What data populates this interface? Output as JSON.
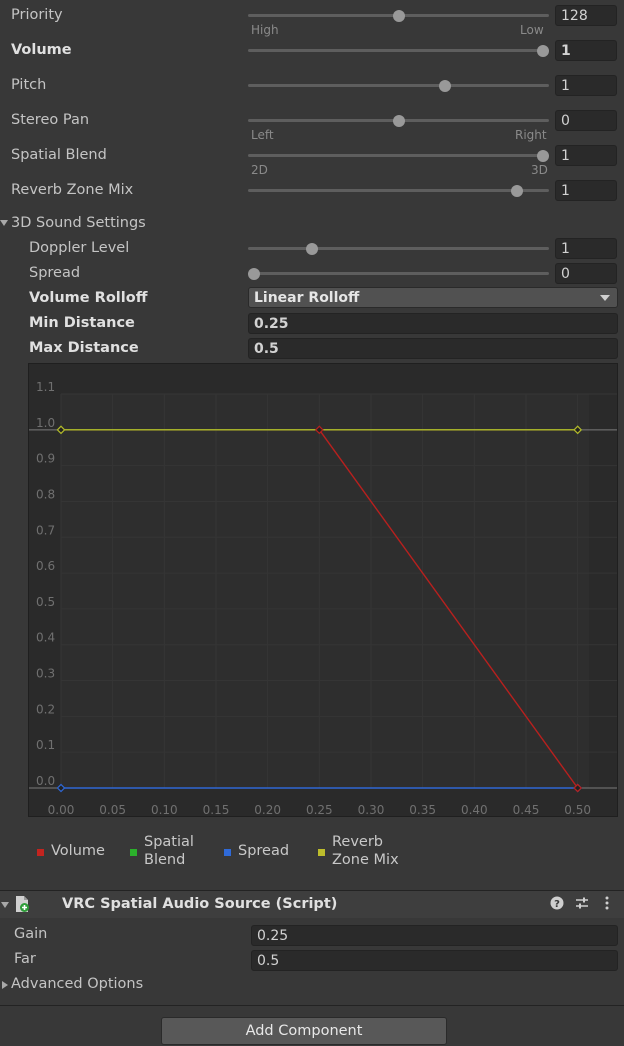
{
  "audio_source": {
    "priority": {
      "label": "Priority",
      "value": "128",
      "min_label": "High",
      "max_label": "Low",
      "fraction": 0.5
    },
    "volume": {
      "label": "Volume",
      "value": "1",
      "fraction": 1.0
    },
    "pitch": {
      "label": "Pitch",
      "value": "1",
      "fraction": 0.66
    },
    "stereo_pan": {
      "label": "Stereo Pan",
      "value": "0",
      "min_label": "Left",
      "max_label": "Right",
      "fraction": 0.5
    },
    "spatial_blend": {
      "label": "Spatial Blend",
      "value": "1",
      "min_label": "2D",
      "max_label": "3D",
      "fraction": 1.0
    },
    "reverb_zone_mix": {
      "label": "Reverb Zone Mix",
      "value": "1",
      "fraction": 0.91
    }
  },
  "sound3d": {
    "header": "3D Sound Settings",
    "doppler_level": {
      "label": "Doppler Level",
      "value": "1",
      "fraction": 0.2
    },
    "spread": {
      "label": "Spread",
      "value": "0",
      "fraction": 0.0
    },
    "volume_rolloff": {
      "label": "Volume Rolloff",
      "value": "Linear Rolloff"
    },
    "min_distance": {
      "label": "Min Distance",
      "value": "0.25"
    },
    "max_distance": {
      "label": "Max Distance",
      "value": "0.5"
    }
  },
  "chart_data": {
    "type": "line",
    "title": "",
    "xlabel": "",
    "ylabel": "",
    "xlim": [
      0,
      0.54
    ],
    "ylim": [
      0,
      1.1
    ],
    "x_ticks": [
      "0.00",
      "0.05",
      "0.10",
      "0.15",
      "0.20",
      "0.25",
      "0.30",
      "0.35",
      "0.40",
      "0.45",
      "0.50"
    ],
    "y_ticks": [
      "0.0",
      "0.1",
      "0.2",
      "0.3",
      "0.4",
      "0.5",
      "0.6",
      "0.7",
      "0.8",
      "0.9",
      "1.0",
      "1.1"
    ],
    "grid": true,
    "series": [
      {
        "name": "Volume",
        "color": "#b8201e",
        "x": [
          0.25,
          0.5
        ],
        "y": [
          1.0,
          0.0
        ]
      },
      {
        "name": "Spatial Blend",
        "color": "#2aa52a",
        "x": [
          0.0,
          0.5
        ],
        "y": [
          1.0,
          1.0
        ]
      },
      {
        "name": "Spread",
        "color": "#2f67d4",
        "x": [
          0.0,
          0.5
        ],
        "y": [
          0.0,
          0.0
        ]
      },
      {
        "name": "Reverb Zone Mix",
        "color": "#b5b52a",
        "x": [
          0.0,
          0.5
        ],
        "y": [
          1.0,
          1.0
        ]
      }
    ],
    "legend": [
      "Volume",
      "Spatial Blend",
      "Spread",
      "Reverb Zone Mix"
    ],
    "legend_position": "bottom"
  },
  "legend_labels": {
    "volume": "Volume",
    "spatial_line1": "Spatial",
    "spatial_line2": "Blend",
    "spread": "Spread",
    "reverb_line1": "Reverb",
    "reverb_line2": "Zone Mix"
  },
  "component": {
    "title": "VRC Spatial Audio Source (Script)",
    "help_icon": "help-icon",
    "presets_icon": "presets-icon",
    "menu_icon": "kebab-menu-icon",
    "gain": {
      "label": "Gain",
      "value": "0.25"
    },
    "far": {
      "label": "Far",
      "value": "0.5"
    },
    "advanced": "Advanced Options"
  },
  "add_component": "Add Component"
}
